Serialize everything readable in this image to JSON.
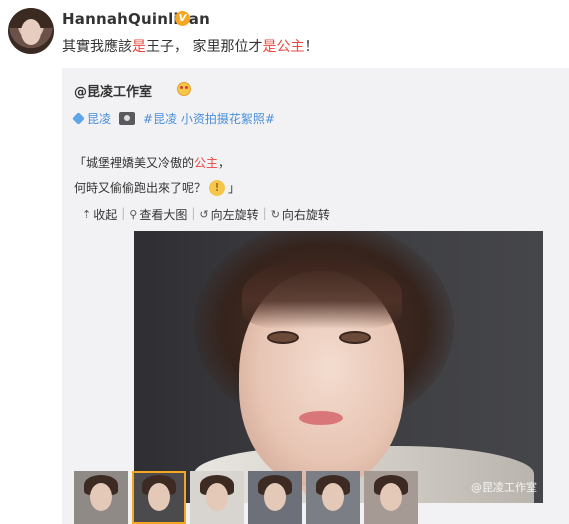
{
  "post": {
    "username": "HannahQuinlivan",
    "text_before": "其實我應該",
    "text_hl1": "是",
    "text_mid": "王子， 家里那位才",
    "text_hl2": "是公主",
    "text_after": "！"
  },
  "repost": {
    "author": "@昆凌工作室",
    "tag1": "昆凌",
    "tag2": "#昆凌 小资拍摄花絮照#",
    "quote_line1_before": "「城堡裡嬌美又冷傲的",
    "quote_line1_hl": "公主",
    "quote_line1_after": "，",
    "quote_line2_before": "何時又偷偷跑出來了呢？",
    "quote_line2_after": "」",
    "toolbar": {
      "collapse": "收起",
      "view_large": "查看大图",
      "rotate_left": "向左旋转",
      "rotate_right": "向右旋转"
    },
    "watermark": "@昆凌工作室"
  },
  "icons": {
    "verified": "verified-badge-icon",
    "emoji": "emoji-icon",
    "diamond": "diamond-icon",
    "camera": "camera-icon",
    "bulb": "lightbulb-icon"
  },
  "colors": {
    "highlight": "#e9473e",
    "link": "#4a90d9",
    "repost_bg": "#f2f2f5",
    "badge": "#f5a623"
  }
}
